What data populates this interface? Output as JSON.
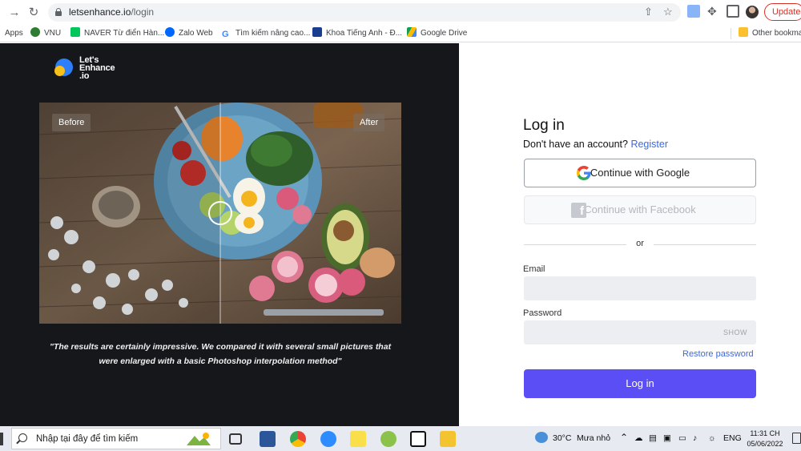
{
  "browser": {
    "url_host": "letsenhance.io",
    "url_path": "/login",
    "update_label": "Update",
    "bookmarks": [
      {
        "label": "Apps",
        "icon": "apps-icon"
      },
      {
        "label": "VNU",
        "icon": "vnu-icon"
      },
      {
        "label": "NAVER Từ điển Hàn...",
        "icon": "naver-icon"
      },
      {
        "label": "Zalo Web",
        "icon": "zalo-icon"
      },
      {
        "label": "Tìm kiếm nâng cao...",
        "icon": "google-icon"
      },
      {
        "label": "Khoa Tiếng Anh - Đ...",
        "icon": "khoa-icon"
      },
      {
        "label": "Google Drive",
        "icon": "drive-icon"
      },
      {
        "label": "Other bookmarks",
        "icon": "folder-icon"
      }
    ]
  },
  "brand": {
    "logo_line1": "Let's",
    "logo_line2": "Enhance",
    "logo_line3": ".io",
    "blue": "#2d7ff9",
    "yellow": "#f7c11a"
  },
  "showcase": {
    "before_label": "Before",
    "after_label": "After",
    "quote_line1": "\"The results are certainly impressive. We compared it with several small pictures that",
    "quote_line2": "were enlarged with a basic Photoshop interpolation method\""
  },
  "login": {
    "title": "Log in",
    "no_account_text": "Don't have an account?",
    "register_link": "Register",
    "google_button": "Continue with Google",
    "facebook_button": "Continue with Facebook",
    "or_text": "or",
    "email_label": "Email",
    "email_value": "",
    "password_label": "Password",
    "password_value": "",
    "show_label": "SHOW",
    "restore_link": "Restore password",
    "submit_label": "Log in",
    "accent": "#5b4ef5",
    "link_color": "#3d68d8"
  },
  "taskbar": {
    "search_placeholder": "Nhập tại đây để tìm kiếm",
    "weather": "30°C",
    "weather_desc": "Mưa nhỏ",
    "language": "ENG",
    "time": "11:31 CH",
    "date": "05/06/2022",
    "apps": [
      "task-view-icon",
      "word-icon",
      "chrome-icon",
      "zoom-icon",
      "sticky-notes-icon",
      "greenshot-icon",
      "notion-icon",
      "file-explorer-icon"
    ]
  }
}
